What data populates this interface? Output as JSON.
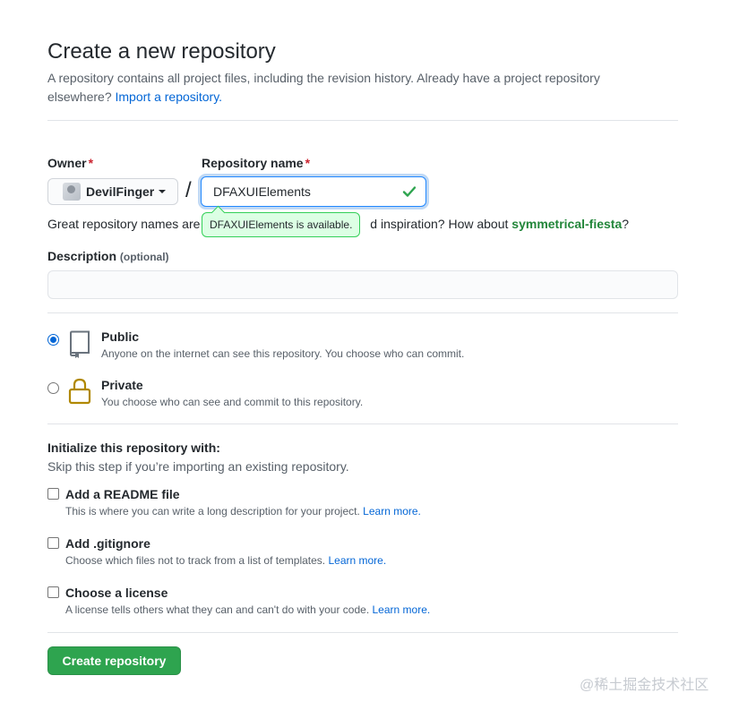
{
  "header": {
    "title": "Create a new repository",
    "subtitle_text": "A repository contains all project files, including the revision history. Already have a project repository elsewhere?",
    "import_link": "Import a repository."
  },
  "owner": {
    "label": "Owner",
    "required_mark": "*",
    "value": "DevilFinger",
    "icon": "avatar"
  },
  "separator": "/",
  "repo_name": {
    "label": "Repository name",
    "required_mark": "*",
    "value": "DFAXUIElements",
    "status_icon": "check-icon",
    "tooltip": "DFAXUIElements is available."
  },
  "helper": {
    "text_start": "Great repository names are",
    "text_mid": "d inspiration? How about",
    "suggestion": "symmetrical-fiesta",
    "text_end": "?"
  },
  "description": {
    "label": "Description",
    "optional_label": "(optional)",
    "value": ""
  },
  "visibility": {
    "options": [
      {
        "title": "Public",
        "description": "Anyone on the internet can see this repository. You choose who can commit.",
        "icon": "repo-icon",
        "selected": true
      },
      {
        "title": "Private",
        "description": "You choose who can see and commit to this repository.",
        "icon": "lock-icon",
        "selected": false
      }
    ]
  },
  "initialize": {
    "title": "Initialize this repository with:",
    "subtitle": "Skip this step if you’re importing an existing repository.",
    "learn_more": "Learn more.",
    "options": [
      {
        "title": "Add a README file",
        "description": "This is where you can write a long description for your project.",
        "checked": false
      },
      {
        "title": "Add .gitignore",
        "description": "Choose which files not to track from a list of templates.",
        "checked": false
      },
      {
        "title": "Choose a license",
        "description": "A license tells others what they can and can't do with your code.",
        "checked": false
      }
    ]
  },
  "submit_label": "Create repository",
  "watermark": "@稀土掘金技术社区",
  "colors": {
    "primary_green": "#2ea44f",
    "link_blue": "#0366d6",
    "success_green": "#22863a",
    "required_red": "#cb2431",
    "lock_gold": "#b08800"
  }
}
